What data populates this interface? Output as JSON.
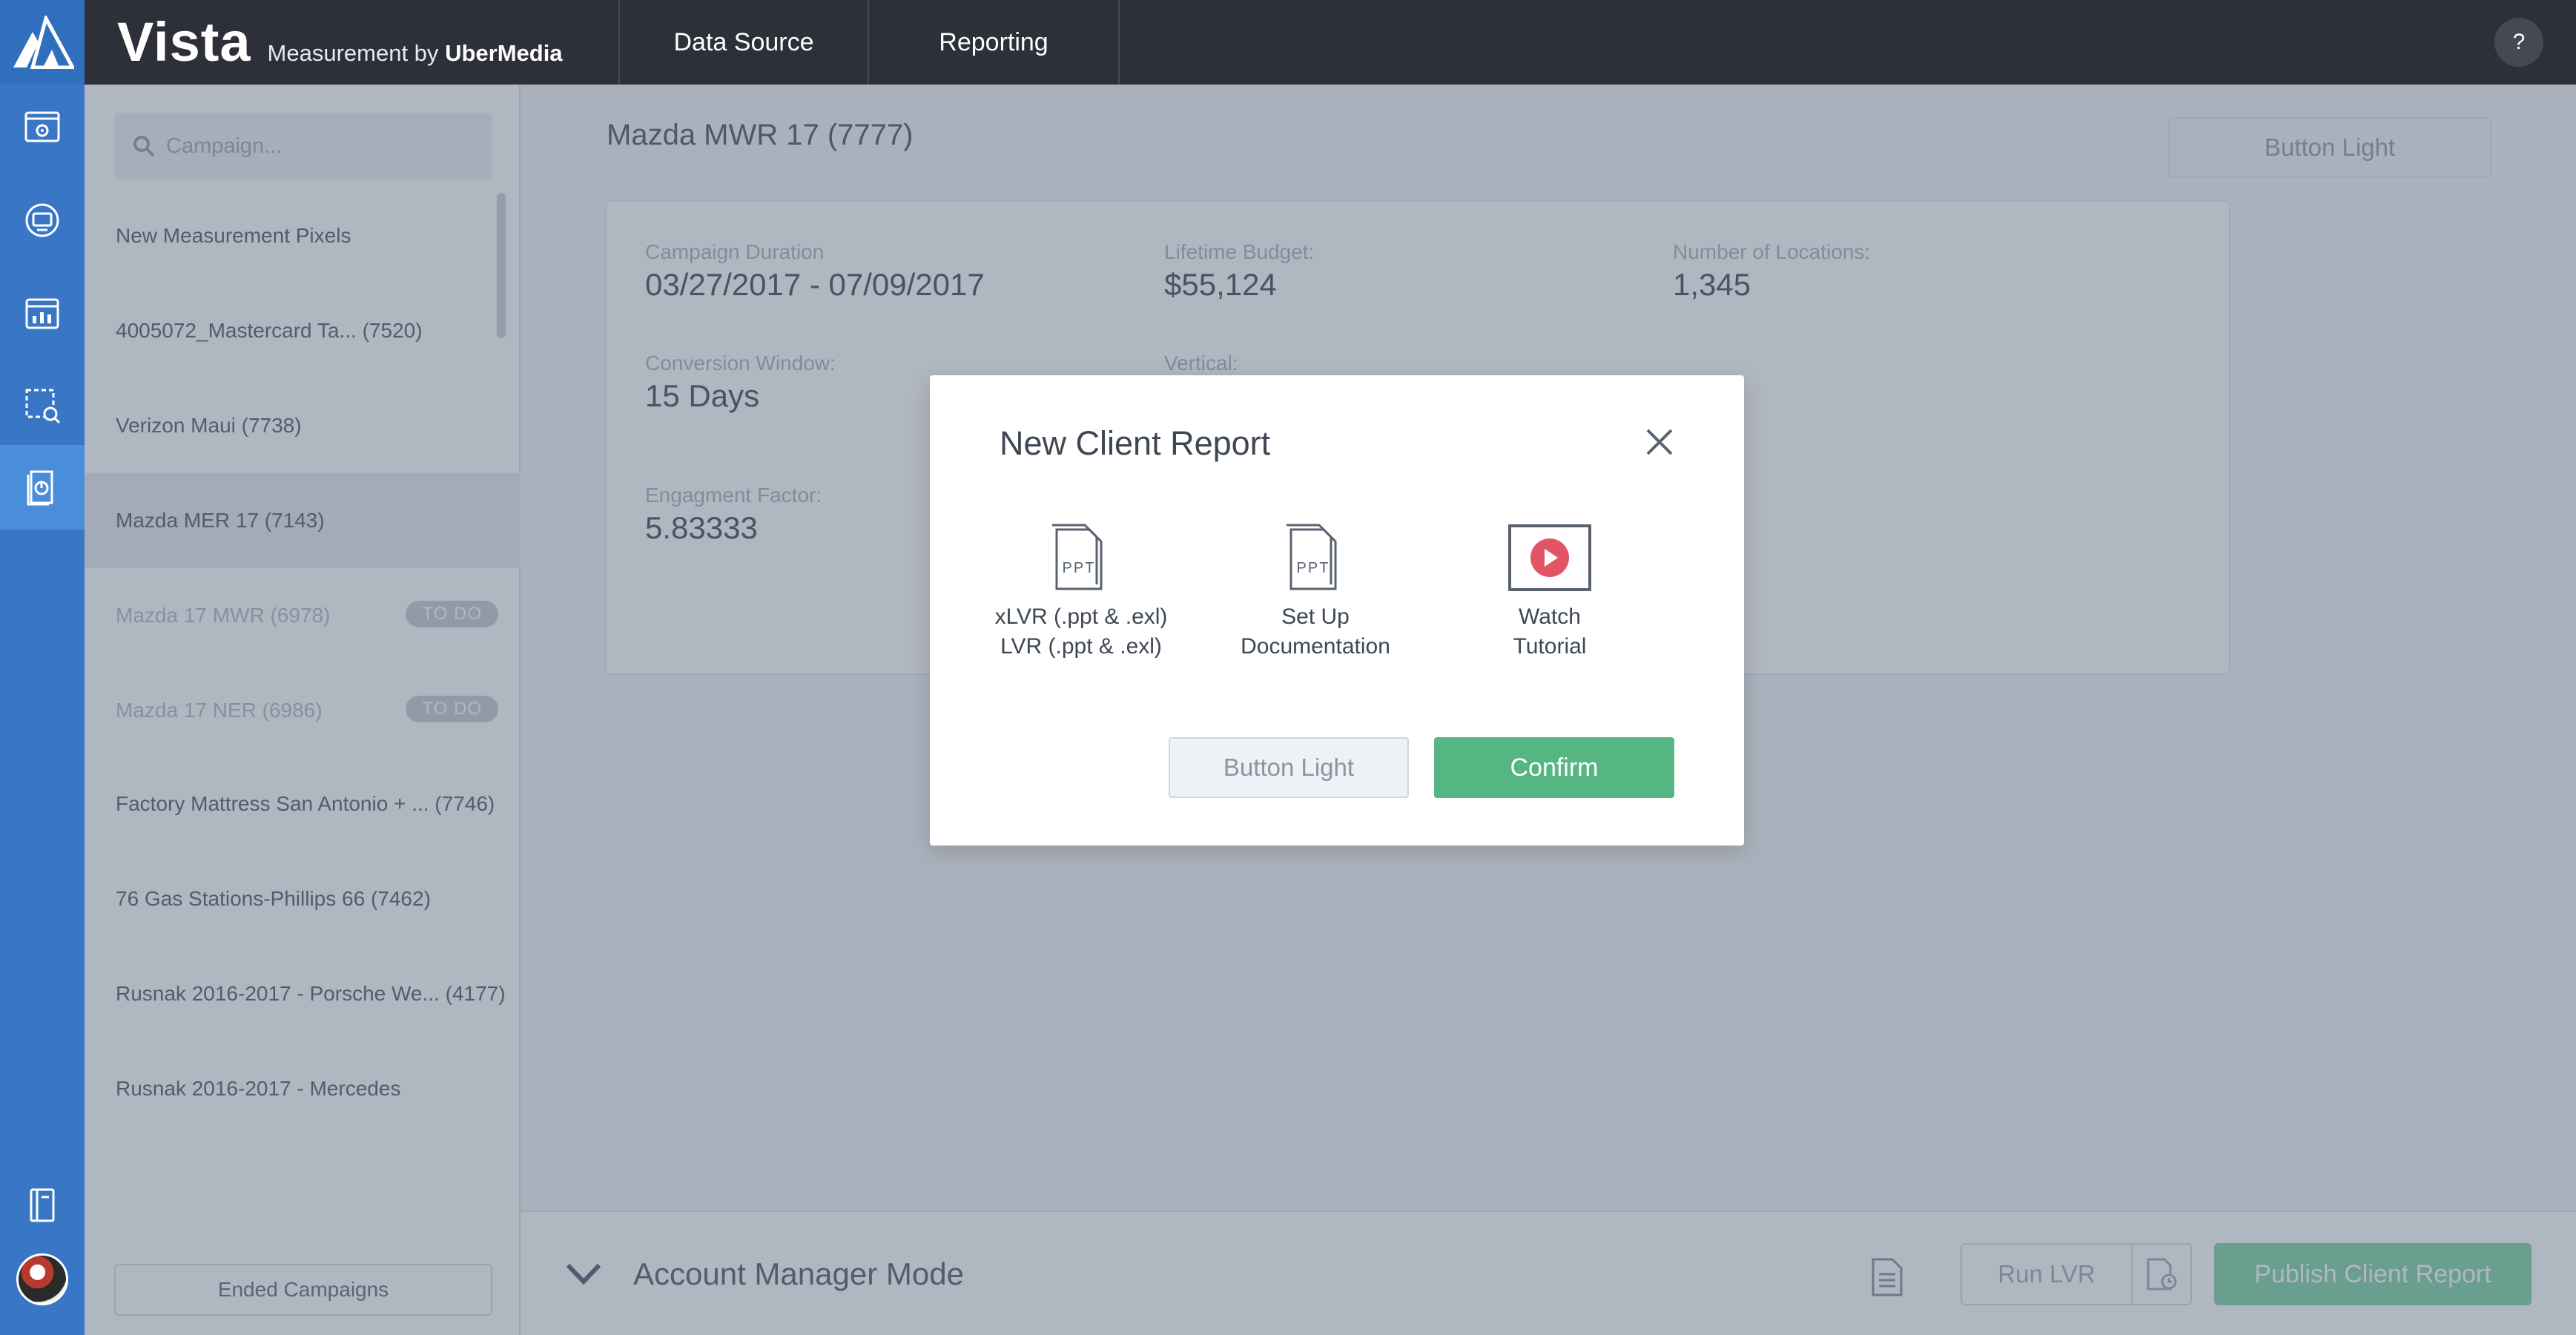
{
  "app": {
    "brand": "Vista",
    "brand_sub_prefix": "Measurement by",
    "brand_sub_company": "UberMedia",
    "help_label": "?"
  },
  "nav": {
    "tabs": [
      {
        "label": "Data Source"
      },
      {
        "label": "Reporting"
      }
    ]
  },
  "rail": {
    "icons": [
      "campaign-icon",
      "advertising-icon",
      "analytics-icon",
      "select-area-icon",
      "reports-icon",
      "notebook-icon",
      "avatar"
    ],
    "active": "reports-icon"
  },
  "sidebar": {
    "search_placeholder": "Campaign...",
    "items": [
      {
        "label": "New Measurement Pixels"
      },
      {
        "label": "4005072_Mastercard Ta... (7520)"
      },
      {
        "label": "Verizon Maui (7738)"
      },
      {
        "label": "Mazda MER 17 (7143)",
        "selected": true
      },
      {
        "label": "Mazda 17 MWR (6978)",
        "badge": "TO DO"
      },
      {
        "label": "Mazda 17 NER (6986)",
        "badge": "TO DO"
      },
      {
        "label": "Factory Mattress San Antonio + ... (7746)"
      },
      {
        "label": "76 Gas Stations-Phillips 66 (7462)"
      },
      {
        "label": "Rusnak 2016-2017 - Porsche We... (4177)"
      },
      {
        "label": "Rusnak 2016-2017 - Mercedes"
      }
    ],
    "ended_button": "Ended Campaigns"
  },
  "main": {
    "title": "Mazda MWR 17 (7777)",
    "top_button": "Button Light",
    "stats": {
      "duration_label": "Campaign Duration",
      "duration_value": "03/27/2017 - 07/09/2017",
      "budget_label": "Lifetime Budget:",
      "budget_value": "$55,124",
      "locations_label": "Number of Locations:",
      "locations_value": "1,345",
      "conversion_label": "Conversion Window:",
      "conversion_value": "15 Days",
      "vertical_label": "Vertical:",
      "engagement_label": "Engagment Factor:",
      "engagement_value": "5.83333"
    }
  },
  "footer": {
    "mode_label": "Account Manager Mode",
    "run_lvr": "Run LVR",
    "publish": "Publish Client Report"
  },
  "modal": {
    "title": "New Client Report",
    "options": [
      {
        "icon": "ppt-file-icon",
        "icon_text": "PPT",
        "line1": "xLVR (.ppt & .exl)",
        "line2": "LVR  (.ppt & .exl)"
      },
      {
        "icon": "ppt-file-icon",
        "icon_text": "PPT",
        "line1": "Set Up",
        "line2": "Documentation"
      },
      {
        "icon": "video-play-icon",
        "line1": "Watch",
        "line2": "Tutorial"
      }
    ],
    "cancel": "Button Light",
    "confirm": "Confirm",
    "colors": {
      "confirm": "#55b682",
      "play": "#e25567"
    }
  }
}
